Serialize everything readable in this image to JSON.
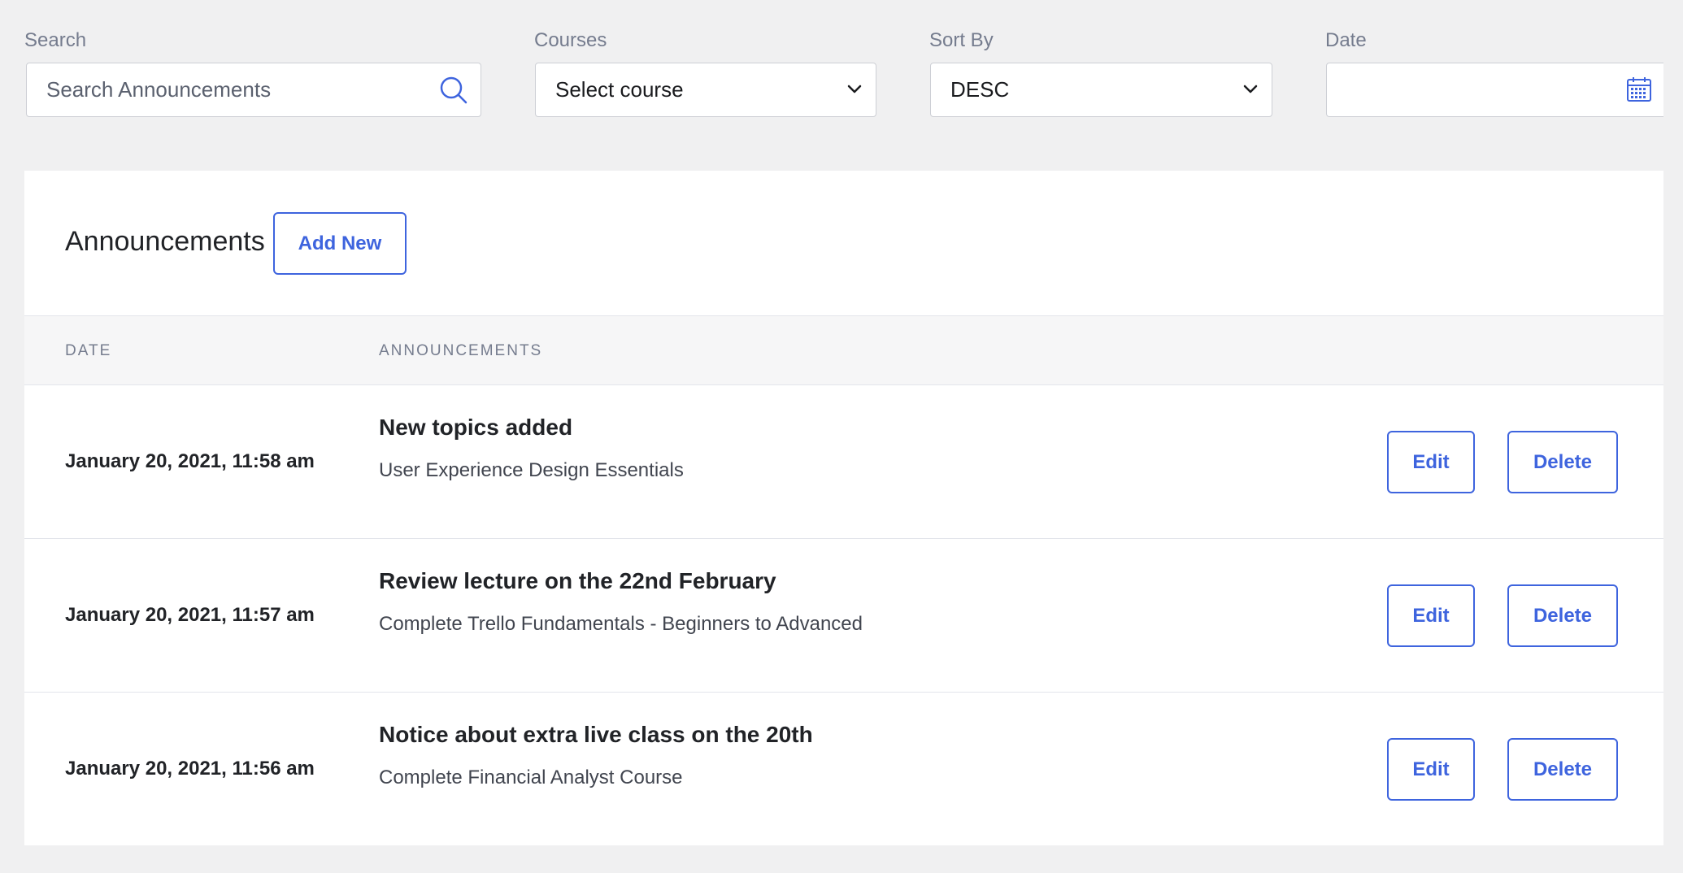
{
  "filters": {
    "search": {
      "label": "Search",
      "placeholder": "Search Announcements"
    },
    "courses": {
      "label": "Courses",
      "value": "Select course"
    },
    "sort": {
      "label": "Sort By",
      "value": "DESC"
    },
    "date": {
      "label": "Date",
      "value": ""
    }
  },
  "panel": {
    "title": "Announcements",
    "add_new_label": "Add New",
    "columns": {
      "date": "DATE",
      "announcements": "ANNOUNCEMENTS"
    },
    "rows": [
      {
        "date": "January 20, 2021, 11:58 am",
        "title": "New topics added",
        "course": "User Experience Design Essentials",
        "edit_label": "Edit",
        "delete_label": "Delete"
      },
      {
        "date": "January 20, 2021, 11:57 am",
        "title": "Review lecture on the 22nd February",
        "course": "Complete Trello Fundamentals - Beginners to Advanced",
        "edit_label": "Edit",
        "delete_label": "Delete"
      },
      {
        "date": "January 20, 2021, 11:56 am",
        "title": "Notice about extra live class on the 20th",
        "course": "Complete Financial Analyst Course",
        "edit_label": "Edit",
        "delete_label": "Delete"
      }
    ]
  },
  "colors": {
    "accent": "#3e64de",
    "background": "#f0f0f1",
    "panel": "#ffffff"
  },
  "icons": {
    "search": "search-icon",
    "dropdown": "chevron-down-icon",
    "date": "calendar-icon"
  }
}
